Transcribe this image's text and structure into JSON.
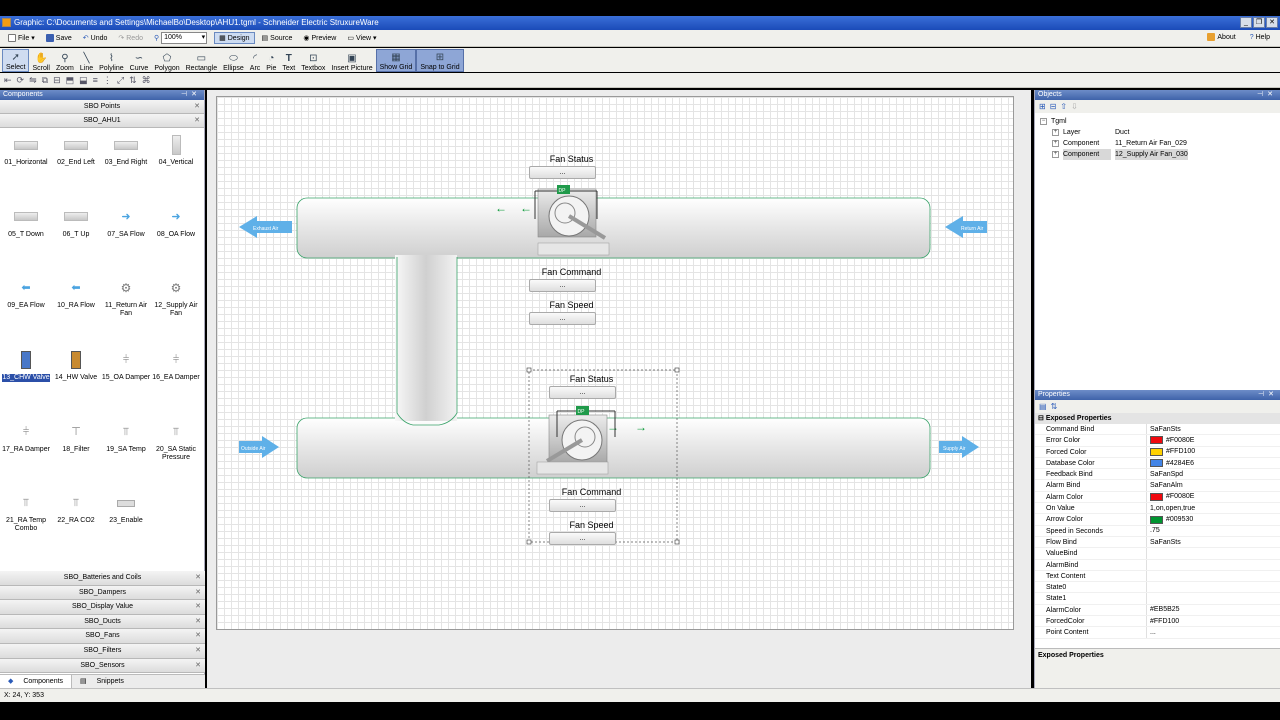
{
  "window": {
    "title": "Graphic: C:\\Documents and Settings\\MichaelBo\\Desktop\\AHU1.tgml - Schneider Electric StruxureWare"
  },
  "menu": {
    "file": "File",
    "save": "Save",
    "undo": "Undo",
    "redo": "Redo",
    "zoom": "100%",
    "design": "Design",
    "source": "Source",
    "preview": "Preview",
    "view": "View",
    "about": "About",
    "help": "Help"
  },
  "tools": [
    "Select",
    "Scroll",
    "Zoom",
    "Line",
    "Polyline",
    "Curve",
    "Polygon",
    "Rectangle",
    "Ellipse",
    "Arc",
    "Pie",
    "Text",
    "Textbox",
    "Insert Picture",
    "Show Grid",
    "Snap to Grid"
  ],
  "components_panel": {
    "title": "Components",
    "top_groups": [
      "SBO Points",
      "SBO_AHU1"
    ],
    "items": [
      "01_Horizontal",
      "02_End Left",
      "03_End Right",
      "04_Vertical",
      "05_T Down",
      "06_T Up",
      "07_SA Flow",
      "08_OA Flow",
      "09_EA Flow",
      "10_RA Flow",
      "11_Return Air Fan",
      "12_Supply Air Fan",
      "13_CHW Valve",
      "14_HW Valve",
      "15_OA Damper",
      "16_EA Damper",
      "17_RA Damper",
      "18_Filter",
      "19_SA Temp",
      "20_SA Static Pressure",
      "21_RA Temp Combo",
      "22_RA CO2",
      "23_Enable"
    ],
    "bottom_groups": [
      "SBO_Batteries and Coils",
      "SBO_Dampers",
      "SBO_Display Value",
      "SBO_Ducts",
      "SBO_Fans",
      "SBO_Filters",
      "SBO_Sensors"
    ],
    "tabs": [
      "Components",
      "Snippets"
    ]
  },
  "canvas": {
    "exhaust": "Exhaust Air",
    "return": "Return Air",
    "outside": "Outside Air",
    "supply": "Supply Air",
    "dp": "DP",
    "fan_status": "Fan Status",
    "fan_command": "Fan Command",
    "fan_speed": "Fan Speed",
    "ellipsis": "..."
  },
  "objects_panel": {
    "title": "Objects",
    "root": "Tgml",
    "rows": [
      {
        "type": "Layer",
        "name": "Duct"
      },
      {
        "type": "Component",
        "name": "11_Return Air Fan_029"
      },
      {
        "type": "Component",
        "name": "12_Supply Air Fan_030"
      }
    ]
  },
  "properties_panel": {
    "title": "Properties",
    "category": "Exposed Properties",
    "rows": [
      {
        "k": "Command Bind",
        "v": "SaFanSts"
      },
      {
        "k": "Error Color",
        "v": "#F0080E",
        "c": "#F0080E"
      },
      {
        "k": "Forced Color",
        "v": "#FFD100",
        "c": "#FFD100"
      },
      {
        "k": "Database Color",
        "v": "#4284E6",
        "c": "#4284E6"
      },
      {
        "k": "Feedback Bind",
        "v": "SaFanSpd"
      },
      {
        "k": "Alarm Bind",
        "v": "SaFanAlm"
      },
      {
        "k": "Alarm Color",
        "v": "#F0080E",
        "c": "#F0080E"
      },
      {
        "k": "On Value",
        "v": "1,on,open,true"
      },
      {
        "k": "Arrow Color",
        "v": "#009530",
        "c": "#009530"
      },
      {
        "k": "Speed in Seconds",
        "v": ".75"
      },
      {
        "k": "Flow Bind",
        "v": "SaFanSts"
      },
      {
        "k": "ValueBind",
        "v": ""
      },
      {
        "k": "AlarmBind",
        "v": ""
      },
      {
        "k": "Text Content",
        "v": ""
      },
      {
        "k": "State0",
        "v": ""
      },
      {
        "k": "State1",
        "v": ""
      },
      {
        "k": "AlarmColor",
        "v": "#EB5B25"
      },
      {
        "k": "ForcedColor",
        "v": "#FFD100"
      },
      {
        "k": "Point Content",
        "v": "..."
      }
    ],
    "description_title": "Exposed Properties"
  },
  "status": {
    "coords": "X: 24, Y: 353"
  }
}
